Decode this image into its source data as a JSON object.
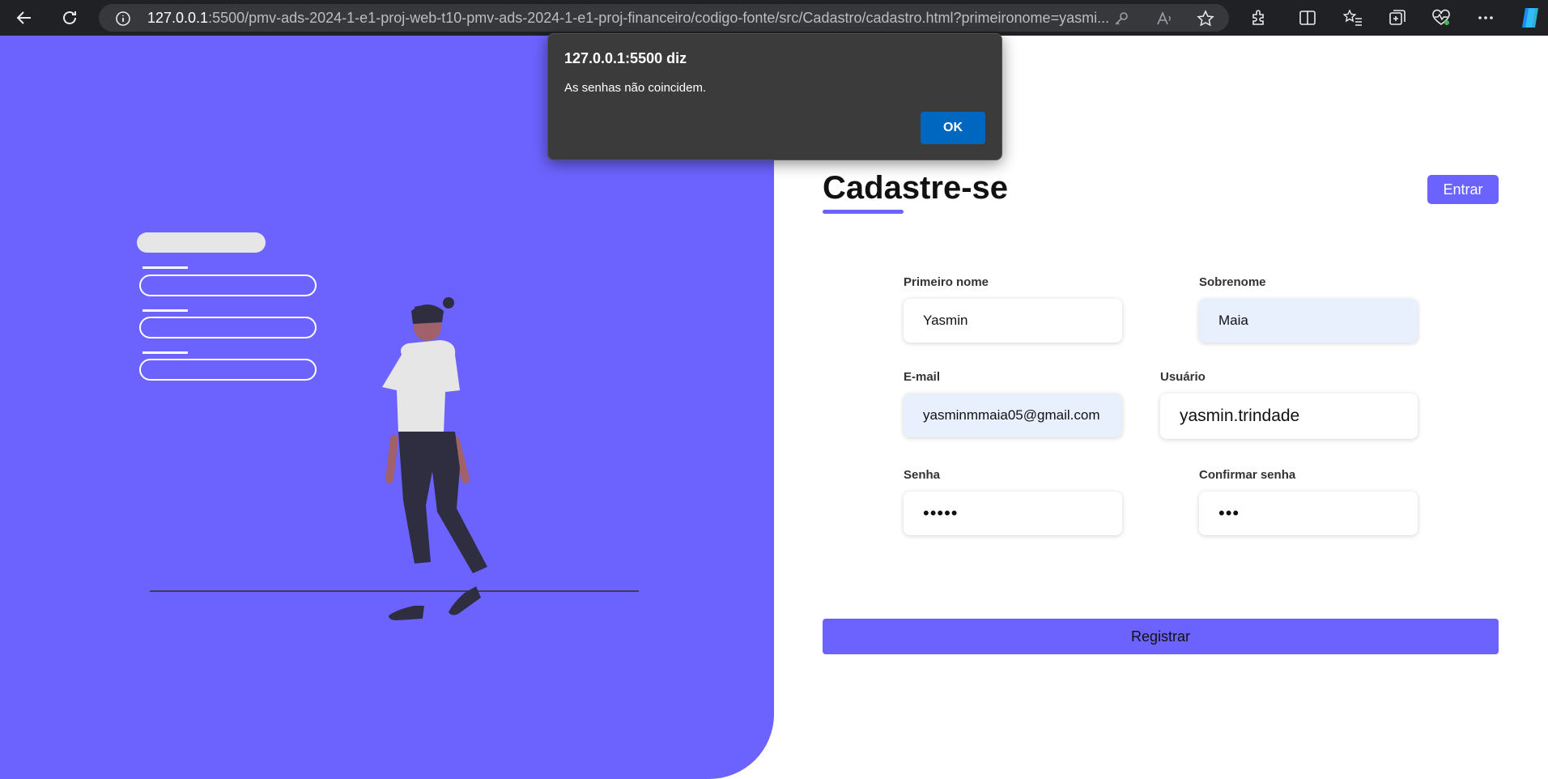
{
  "browser": {
    "url_host": "127.0.0.1",
    "url_rest": ":5500/pmv-ads-2024-1-e1-proj-web-t10-pmv-ads-2024-1-e1-proj-financeiro/codigo-fonte/src/Cadastro/cadastro.html?primeironome=yasmi..."
  },
  "page": {
    "title": "Cadastre-se",
    "login_button": "Entrar",
    "submit_button": "Registrar"
  },
  "form": {
    "first_name": {
      "label": "Primeiro nome",
      "value": "Yasmin"
    },
    "last_name": {
      "label": "Sobrenome",
      "value": "Maia"
    },
    "email": {
      "label": "E-mail",
      "value": "yasminmmaia05@gmail.com"
    },
    "username": {
      "label": "Usuário",
      "value": "yasmin.trindade"
    },
    "password": {
      "label": "Senha",
      "value": "•••••"
    },
    "confirm_password": {
      "label": "Confirmar senha",
      "value": "•••"
    }
  },
  "dialog": {
    "title": "127.0.0.1:5500 diz",
    "message": "As senhas não coincidem.",
    "ok_label": "OK"
  },
  "colors": {
    "accent": "#6c63ff",
    "dialog_button": "#0067c0"
  }
}
